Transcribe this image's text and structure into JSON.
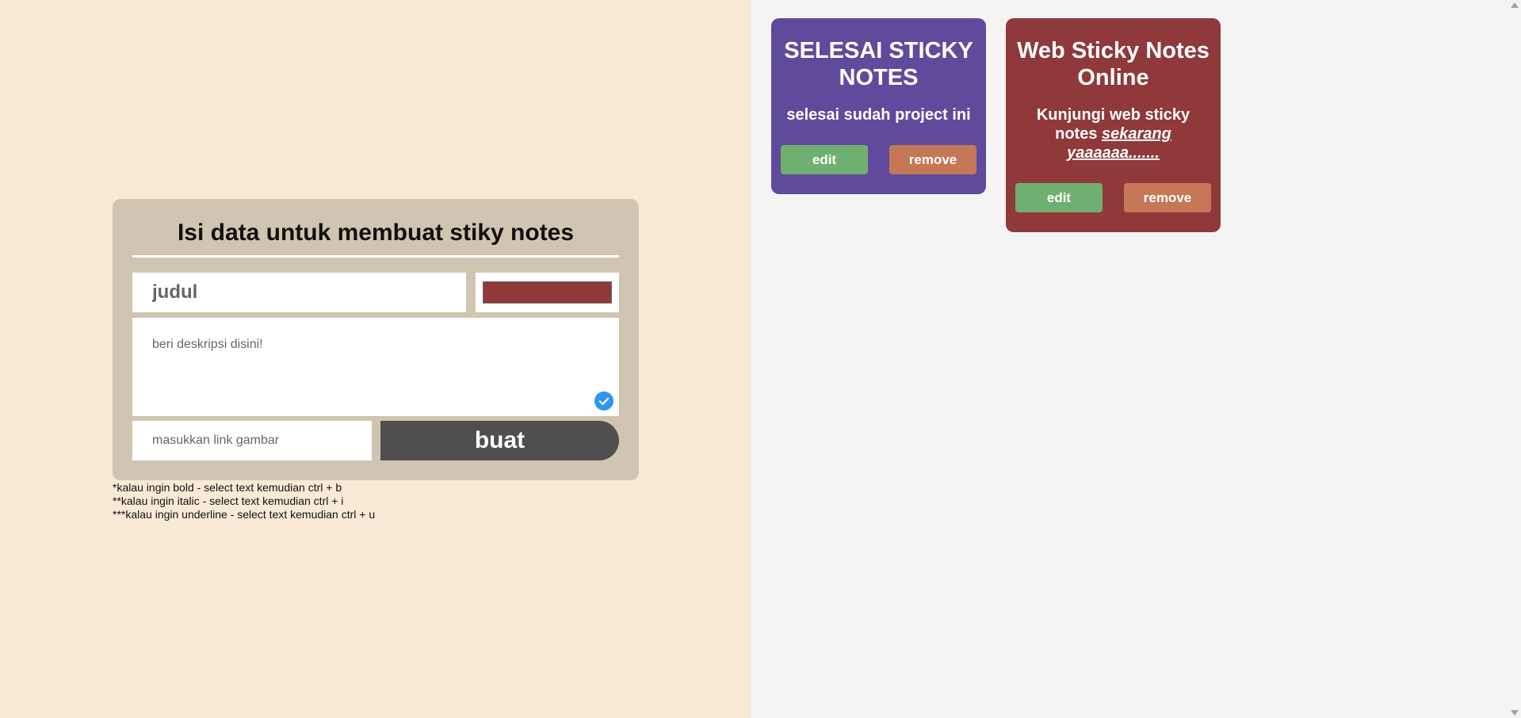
{
  "form": {
    "title": "Isi data untuk membuat stiky notes",
    "title_placeholder": "judul",
    "selected_color": "#8f393a",
    "description_placeholder": "beri deskripsi disini!",
    "image_link_placeholder": "masukkan link gambar",
    "submit_label": "buat"
  },
  "hints": [
    "*kalau ingin bold - select text kemudian ctrl + b",
    "**kalau ingin italic - select text kemudian ctrl + i",
    "***kalau ingin underline - select text kemudian ctrl + u"
  ],
  "notes": [
    {
      "title": "SELESAI STICKY NOTES",
      "description": "selesai sudah project ini",
      "color": "#604a9b",
      "edit_label": "edit",
      "remove_label": "remove"
    },
    {
      "title": "Web Sticky Notes Online",
      "description_plain": "Kunjungi web sticky notes ",
      "description_emphasis": "sekarang yaaaaaa.......",
      "color": "#8f393a",
      "edit_label": "edit",
      "remove_label": "remove"
    }
  ],
  "colors": {
    "left_bg": "#f9ead6",
    "form_bg": "#d0c5b0",
    "right_bg": "#f4f4f4",
    "edit_btn": "#6faf70",
    "remove_btn": "#c47857",
    "submit_btn": "#4f4f4f"
  }
}
